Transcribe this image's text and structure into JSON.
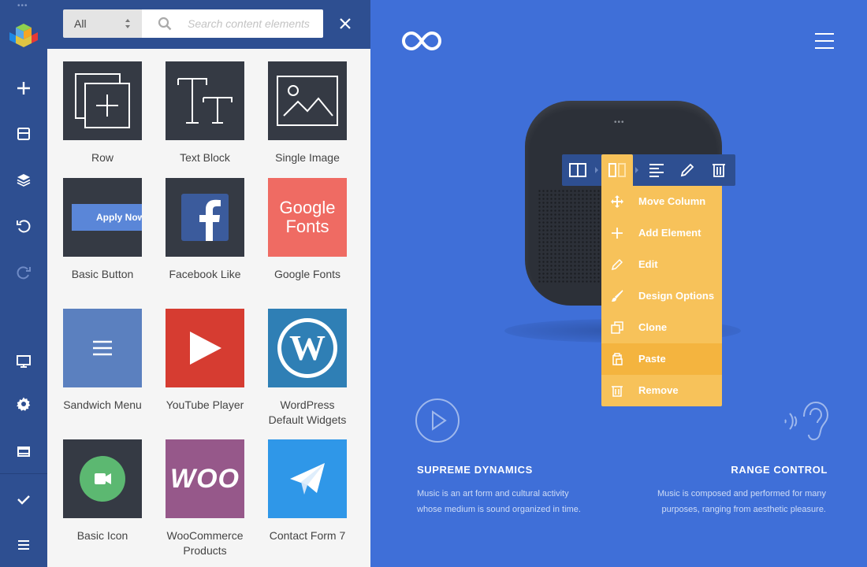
{
  "sidebar": {
    "buttons": [
      "add-element",
      "templates",
      "layers",
      "undo",
      "redo",
      "responsive-preview",
      "settings",
      "frontend-store",
      "save",
      "menu"
    ]
  },
  "panel": {
    "filter_value": "All",
    "search_placeholder": "Search content elements",
    "elements": [
      {
        "label": "Row"
      },
      {
        "label": "Text Block"
      },
      {
        "label": "Single Image"
      },
      {
        "label": "Basic Button",
        "thumb_text": "Apply Now"
      },
      {
        "label": "Facebook Like"
      },
      {
        "label": "Google Fonts",
        "thumb_line1": "Google",
        "thumb_line2": "Fonts"
      },
      {
        "label": "Sandwich Menu"
      },
      {
        "label": "YouTube Player"
      },
      {
        "label_line1": "WordPress",
        "label_line2": "Default Widgets"
      },
      {
        "label": "Basic Icon"
      },
      {
        "label_line1": "WooCommerce",
        "label_line2": "Products",
        "thumb_text": "WOO"
      },
      {
        "label": "Contact Form 7"
      }
    ]
  },
  "canvas": {
    "context_menu": [
      {
        "label": "Move Column",
        "icon": "move-icon"
      },
      {
        "label": "Add Element",
        "icon": "plus-icon"
      },
      {
        "label": "Edit",
        "icon": "pencil-icon"
      },
      {
        "label": "Design Options",
        "icon": "brush-icon"
      },
      {
        "label": "Clone",
        "icon": "clone-icon"
      },
      {
        "label": "Paste",
        "icon": "paste-icon"
      },
      {
        "label": "Remove",
        "icon": "trash-icon"
      }
    ],
    "features": [
      {
        "title": "SUPREME DYNAMICS",
        "line1": "Music is an art form and cultural activity",
        "line2": "whose medium is sound organized in time."
      },
      {
        "title": "RANGE CONTROL",
        "line1": "Music is composed and performed for many",
        "line2": "purposes, ranging from aesthetic pleasure."
      }
    ]
  },
  "colors": {
    "rail": "#2e4f91",
    "canvas": "#3f6fd8",
    "menu_accent": "#f7c25a",
    "google_fonts": "#ef6b63",
    "youtube": "#d63c31",
    "wordpress": "#2f7fb5",
    "woocommerce": "#96588a",
    "contact_form": "#2f97e8"
  }
}
